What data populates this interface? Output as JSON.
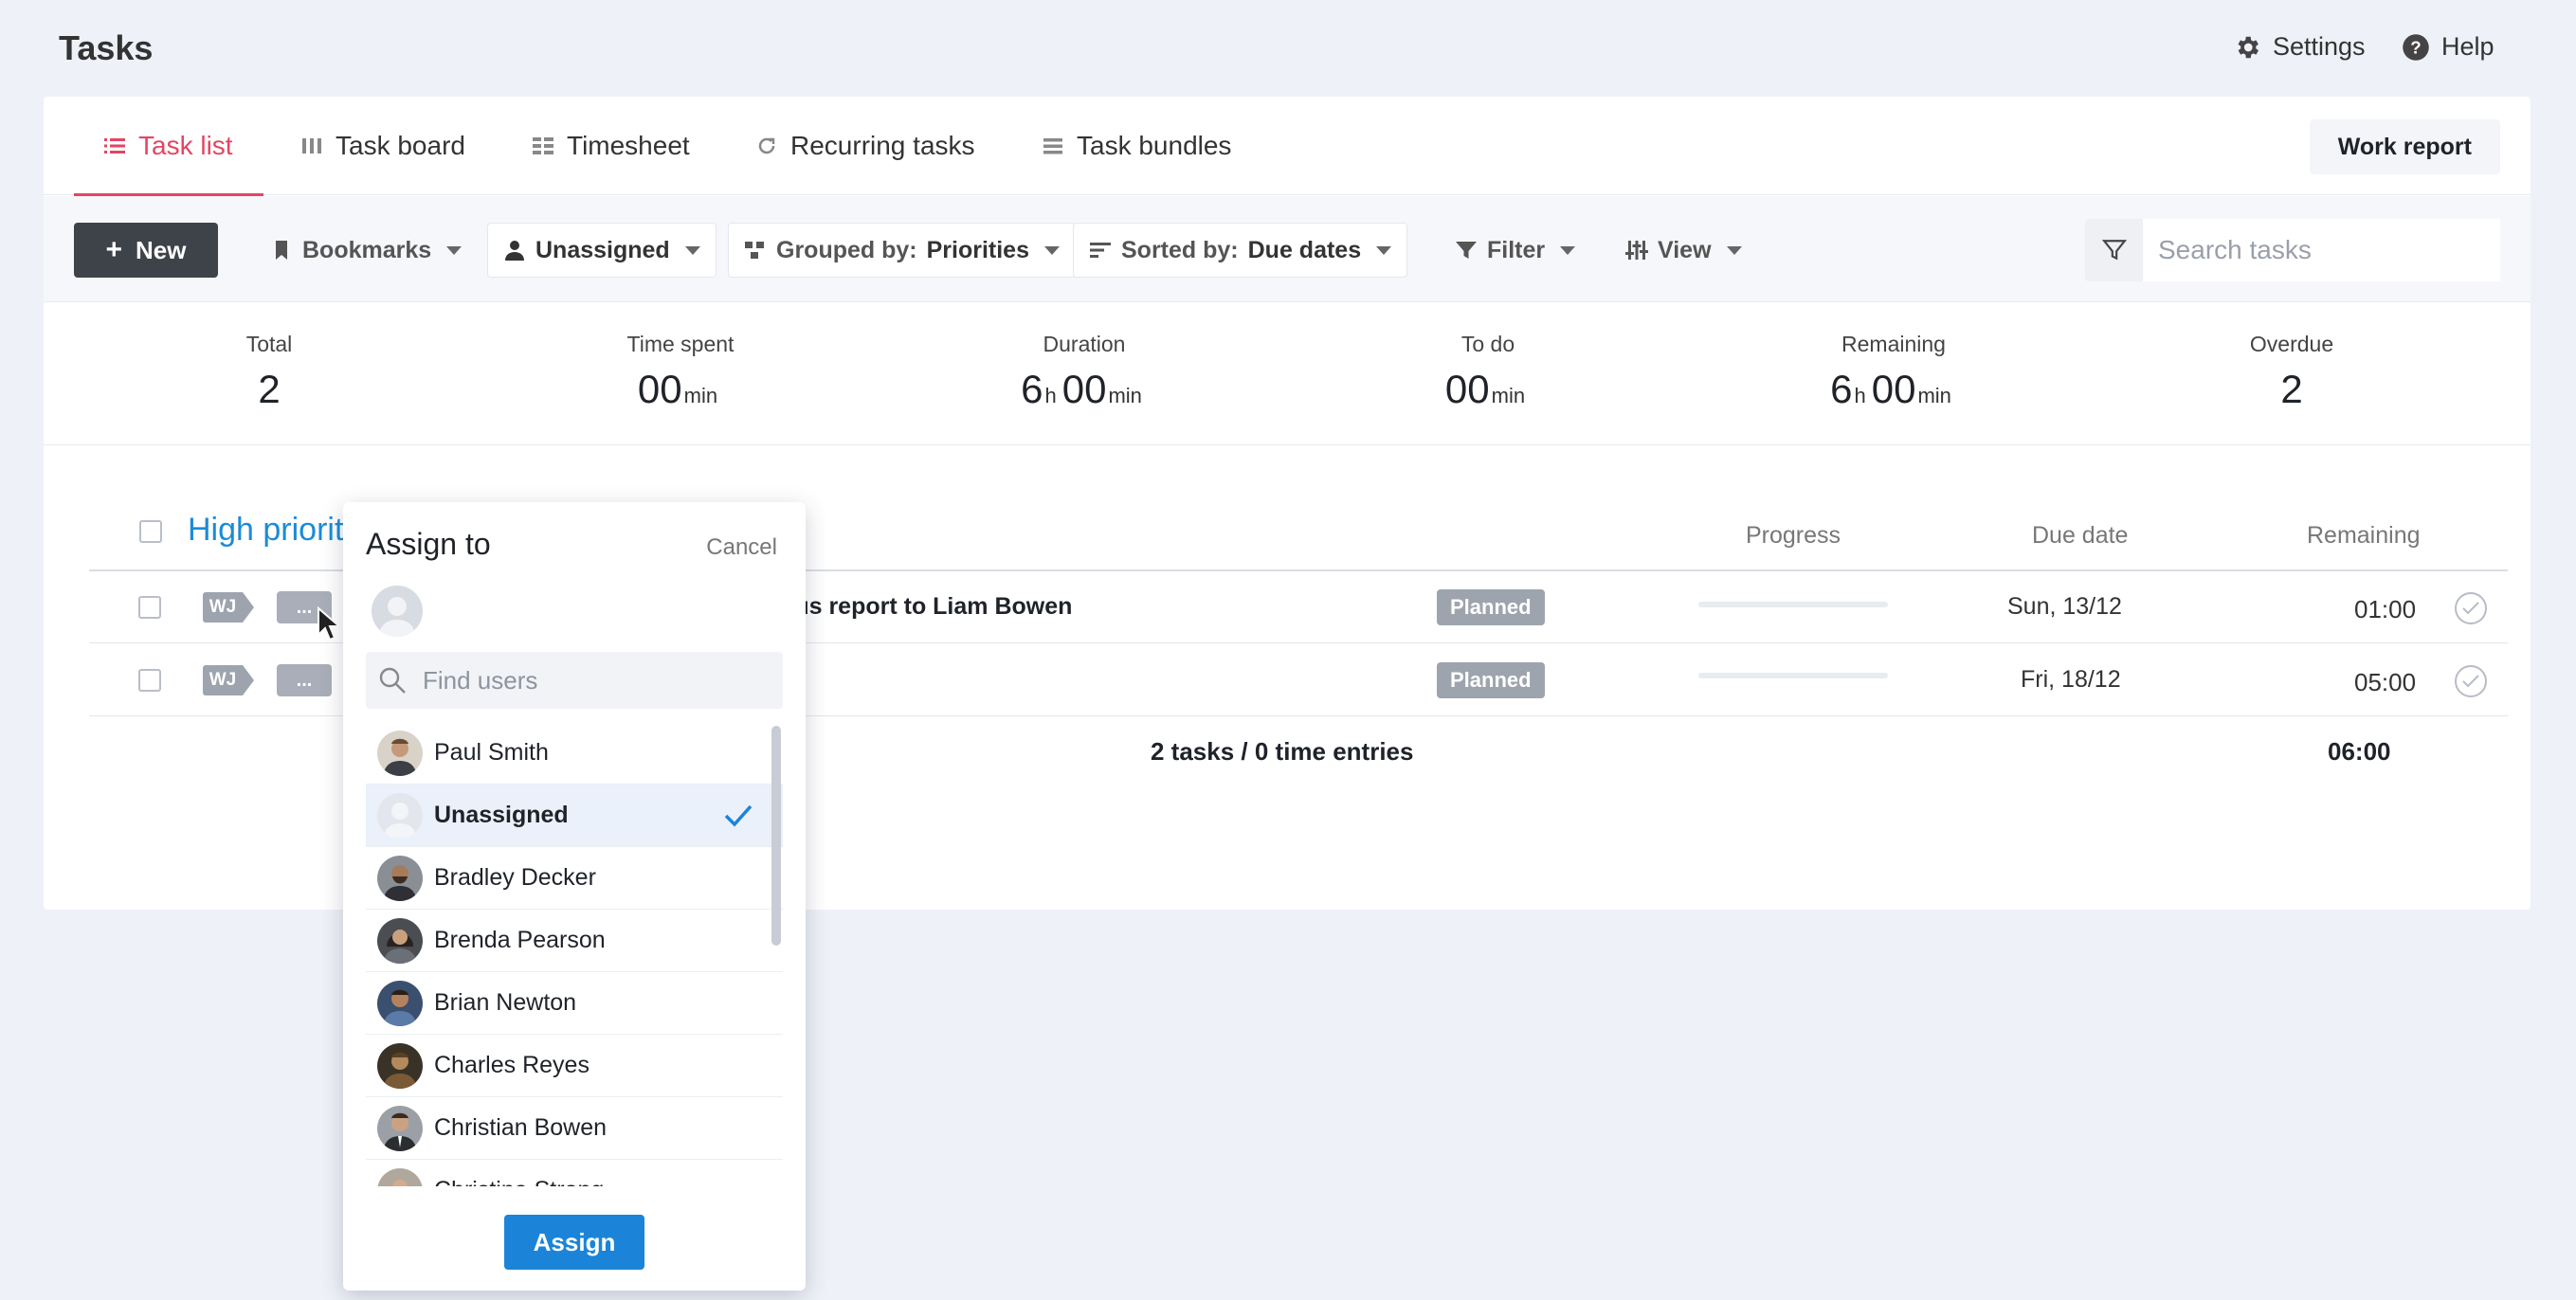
{
  "header": {
    "title": "Tasks",
    "settings_label": "Settings",
    "help_label": "Help"
  },
  "tabs": [
    {
      "label": "Task list",
      "icon": "list-icon",
      "active": true
    },
    {
      "label": "Task board",
      "icon": "board-icon",
      "active": false
    },
    {
      "label": "Timesheet",
      "icon": "timesheet-icon",
      "active": false
    },
    {
      "label": "Recurring tasks",
      "icon": "recurring-icon",
      "active": false
    },
    {
      "label": "Task bundles",
      "icon": "bundles-icon",
      "active": false
    }
  ],
  "work_report_label": "Work report",
  "toolbar": {
    "new_label": "New",
    "bookmarks_label": "Bookmarks",
    "assignee_label": "Unassigned",
    "grouped_prefix": "Grouped by:",
    "grouped_value": "Priorities",
    "sorted_prefix": "Sorted by:",
    "sorted_value": "Due dates",
    "filter_label": "Filter",
    "view_label": "View",
    "search_placeholder": "Search tasks"
  },
  "stats": {
    "total": {
      "label": "Total",
      "value": "2"
    },
    "time_spent": {
      "label": "Time spent",
      "value": "00",
      "unit": "min"
    },
    "duration": {
      "label": "Duration",
      "hours": "6",
      "h_unit": "h",
      "minutes": "00",
      "m_unit": "min"
    },
    "to_do": {
      "label": "To do",
      "value": "00",
      "unit": "min"
    },
    "remaining": {
      "label": "Remaining",
      "hours": "6",
      "h_unit": "h",
      "minutes": "00",
      "m_unit": "min"
    },
    "overdue": {
      "label": "Overdue",
      "value": "2"
    }
  },
  "table": {
    "group_title": "High priorit",
    "columns": {
      "progress": "Progress",
      "due_date": "Due date",
      "remaining": "Remaining"
    },
    "rows": [
      {
        "tag": "WJ",
        "more": "...",
        "name": "tus report to Liam Bowen",
        "status": "Planned",
        "progress": 0,
        "due": "Sun, 13/12",
        "remaining": "01:00"
      },
      {
        "tag": "WJ",
        "more": "...",
        "name": "",
        "status": "Planned",
        "progress": 0,
        "due": "Fri, 18/12",
        "remaining": "05:00"
      }
    ],
    "footer_summary": "2 tasks / 0 time entries",
    "footer_total": "06:00"
  },
  "assign_popup": {
    "title": "Assign to",
    "cancel_label": "Cancel",
    "find_placeholder": "Find users",
    "users": [
      {
        "name": "Paul Smith",
        "selected": false,
        "avatar": "paul-smith-avatar"
      },
      {
        "name": "Unassigned",
        "selected": true,
        "avatar": "placeholder-avatar"
      },
      {
        "name": "Bradley Decker",
        "selected": false,
        "avatar": "bradley-decker-avatar"
      },
      {
        "name": "Brenda Pearson",
        "selected": false,
        "avatar": "brenda-pearson-avatar"
      },
      {
        "name": "Brian Newton",
        "selected": false,
        "avatar": "brian-newton-avatar"
      },
      {
        "name": "Charles Reyes",
        "selected": false,
        "avatar": "charles-reyes-avatar"
      },
      {
        "name": "Christian Bowen",
        "selected": false,
        "avatar": "christian-bowen-avatar"
      },
      {
        "name": "Christina Strong",
        "selected": false,
        "avatar": "christina-strong-avatar"
      }
    ],
    "assign_label": "Assign"
  },
  "colors": {
    "accent_active_tab": "#e34564",
    "link_blue": "#1b8bd6",
    "primary_button": "#1b84d8",
    "dark_button": "#3e4249",
    "badge_gray": "#9ea4ae"
  }
}
